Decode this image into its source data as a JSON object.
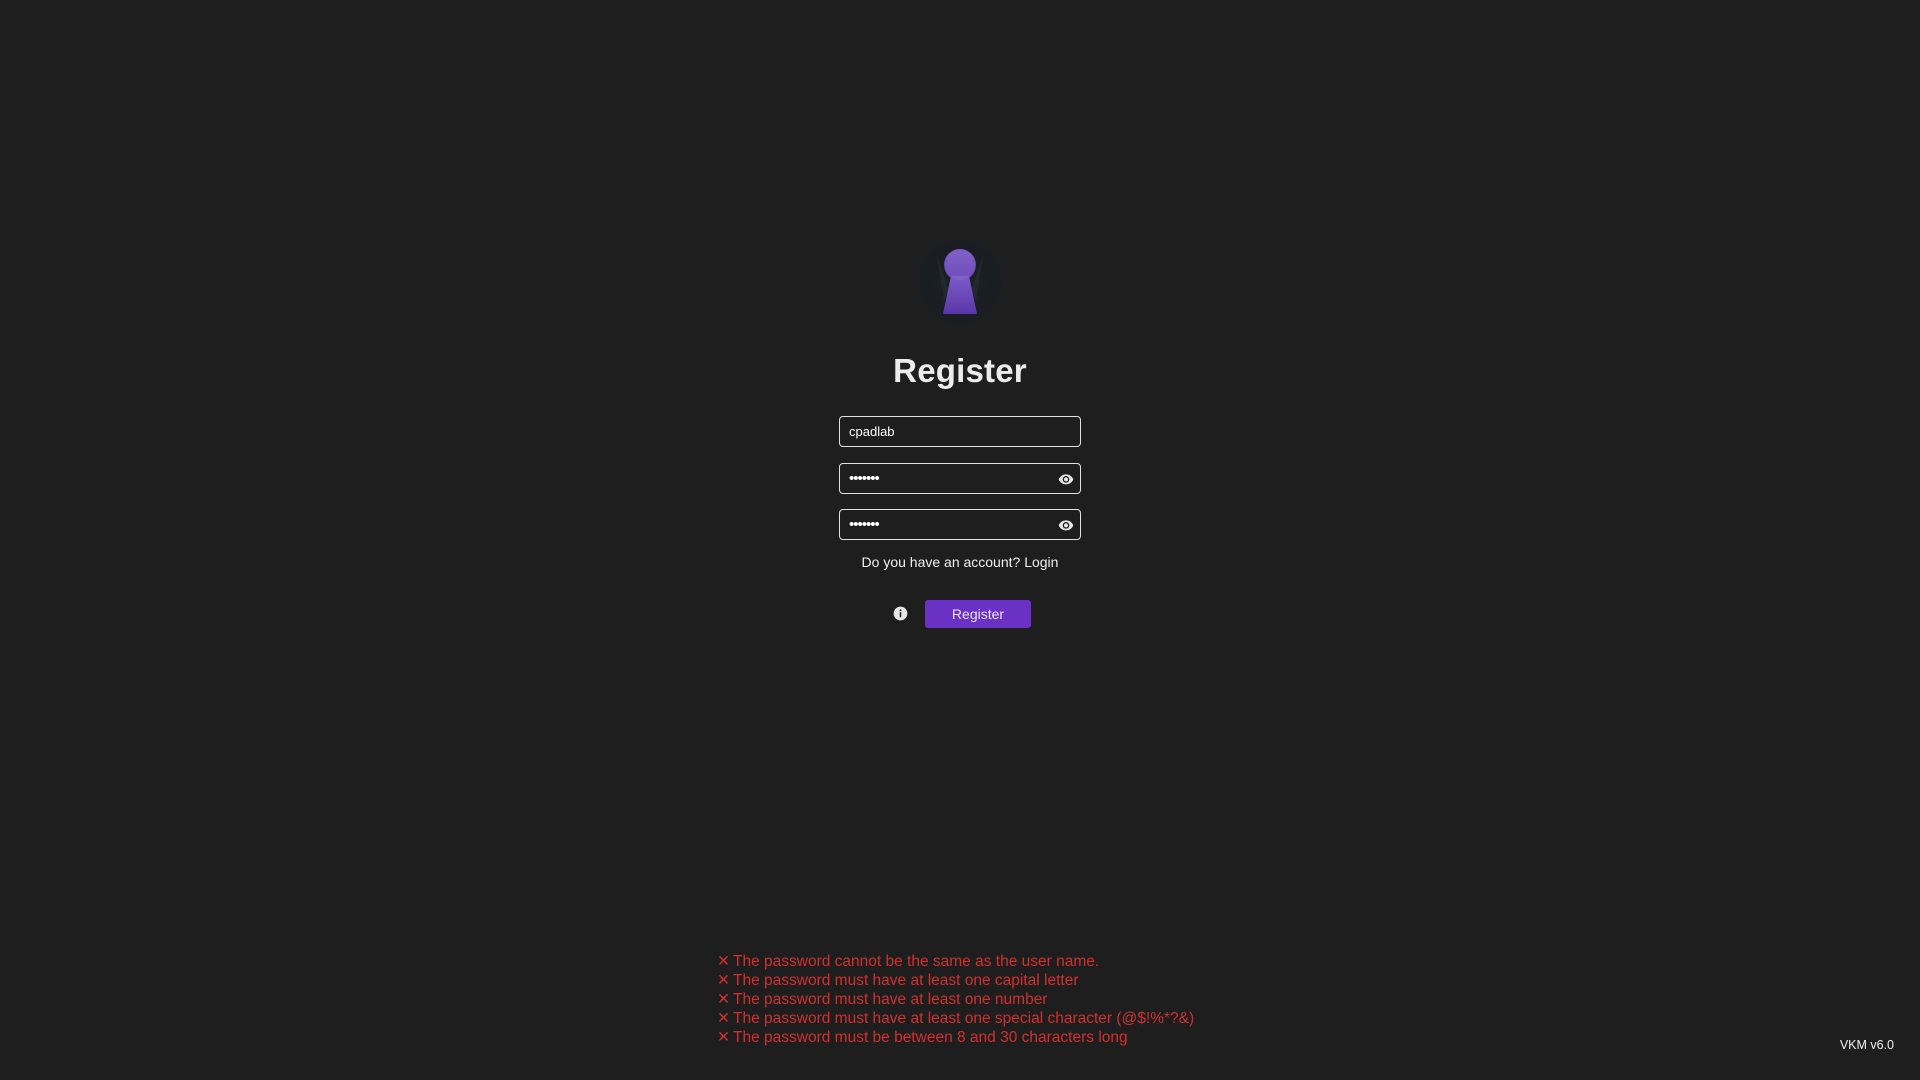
{
  "app": {
    "title": "Register",
    "version": "VKM v6.0"
  },
  "colors": {
    "background": "#1e1e1e",
    "accent": "#6a31c4",
    "error": "#d32f2f",
    "field_border": "#e2e2e2"
  },
  "form": {
    "username": {
      "value": "cpadlab",
      "icon": null
    },
    "password": {
      "value": "•••••••",
      "icon": "eye-icon"
    },
    "confirm_password": {
      "value": "•••••••",
      "icon": "eye-icon"
    },
    "account_prompt": "Do you have an account?",
    "login_link": "Login",
    "info_icon": "info-icon",
    "register_button": "Register"
  },
  "logo": {
    "icon": "keyhole-logo"
  },
  "errors": [
    {
      "icon": "✕",
      "text": "The password cannot be the same as the user name."
    },
    {
      "icon": "✕",
      "text": "The password must have at least one capital letter"
    },
    {
      "icon": "✕",
      "text": "The password must have at least one number"
    },
    {
      "icon": "✕",
      "text": "The password must have at least one special character (@$!%*?&)"
    },
    {
      "icon": "✕",
      "text": "The password must be between 8 and 30 characters long"
    }
  ]
}
